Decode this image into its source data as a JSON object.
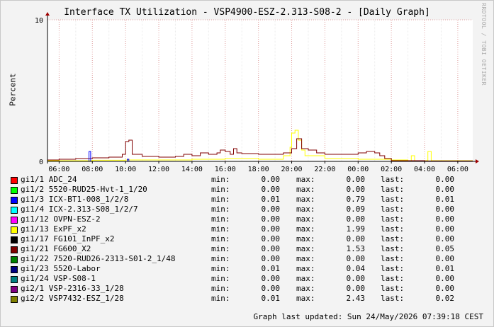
{
  "title": "Interface TX Utilization - VSP4900-ESZ-2.313-S08-2 - [Daily Graph]",
  "watermark": "RRDTOOL / TOBI OETIKER",
  "colors": {
    "background": "#f3f3f3",
    "plot": "#ffffff",
    "grid": "#e08080",
    "axis": "#000000",
    "arrow": "#a00000"
  },
  "chart_data": {
    "type": "line",
    "ylabel": "Percent",
    "ylim": [
      0,
      10
    ],
    "y_ticks": [
      "0",
      "10"
    ],
    "x_ticks": [
      "06:00",
      "08:00",
      "10:00",
      "12:00",
      "14:00",
      "16:00",
      "18:00",
      "20:00",
      "22:00",
      "00:00",
      "02:00",
      "04:00",
      "06:00"
    ],
    "x_tick_hours": [
      6,
      8,
      10,
      12,
      14,
      16,
      18,
      20,
      22,
      24,
      26,
      28,
      30
    ],
    "x_range_hours": [
      5.3,
      30.9
    ],
    "series": [
      {
        "name": "gi1/13 ExPF_x2",
        "color": "#ffff00",
        "points": [
          [
            5.3,
            0.05
          ],
          [
            8,
            0.08
          ],
          [
            10,
            0.1
          ],
          [
            12,
            0.1
          ],
          [
            14,
            0.15
          ],
          [
            16,
            0.2
          ],
          [
            18,
            0.15
          ],
          [
            19.5,
            0.4
          ],
          [
            19.9,
            1.0
          ],
          [
            20.0,
            2.0
          ],
          [
            20.2,
            2.2
          ],
          [
            20.4,
            1.5
          ],
          [
            20.6,
            0.8
          ],
          [
            20.8,
            0.4
          ],
          [
            22,
            0.2
          ],
          [
            24,
            0.15
          ],
          [
            26,
            0.1
          ],
          [
            27,
            0.05
          ],
          [
            27.2,
            0.4
          ],
          [
            27.4,
            0.05
          ],
          [
            28,
            0.05
          ],
          [
            28.2,
            0.7
          ],
          [
            28.4,
            0.05
          ],
          [
            30.9,
            0.05
          ]
        ]
      },
      {
        "name": "gi1/21 FG600_X2",
        "color": "#800000",
        "points": [
          [
            5.3,
            0.1
          ],
          [
            6,
            0.15
          ],
          [
            7,
            0.2
          ],
          [
            8,
            0.25
          ],
          [
            9,
            0.3
          ],
          [
            9.5,
            0.3
          ],
          [
            9.8,
            0.5
          ],
          [
            10.0,
            1.4
          ],
          [
            10.2,
            1.5
          ],
          [
            10.4,
            0.5
          ],
          [
            11,
            0.35
          ],
          [
            12,
            0.3
          ],
          [
            13,
            0.35
          ],
          [
            13.5,
            0.5
          ],
          [
            14,
            0.4
          ],
          [
            14.5,
            0.6
          ],
          [
            15,
            0.5
          ],
          [
            15.5,
            0.6
          ],
          [
            15.7,
            0.8
          ],
          [
            16,
            0.7
          ],
          [
            16.3,
            0.5
          ],
          [
            16.5,
            0.9
          ],
          [
            16.7,
            0.6
          ],
          [
            17,
            0.55
          ],
          [
            18,
            0.5
          ],
          [
            19,
            0.5
          ],
          [
            19.5,
            0.6
          ],
          [
            20,
            0.9
          ],
          [
            20.3,
            1.6
          ],
          [
            20.6,
            0.9
          ],
          [
            21,
            0.8
          ],
          [
            21.5,
            0.6
          ],
          [
            22,
            0.5
          ],
          [
            23,
            0.5
          ],
          [
            24,
            0.6
          ],
          [
            24.5,
            0.7
          ],
          [
            25,
            0.6
          ],
          [
            25.3,
            0.4
          ],
          [
            25.6,
            0.2
          ],
          [
            26,
            0.05
          ],
          [
            27,
            0.05
          ],
          [
            28,
            0.03
          ],
          [
            30,
            0.03
          ],
          [
            30.9,
            0.03
          ]
        ]
      },
      {
        "name": "gi1/3 ICX-BT1-008_1/2/8",
        "color": "#0000ff",
        "points": [
          [
            5.3,
            0
          ],
          [
            7.7,
            0
          ],
          [
            7.8,
            0.7
          ],
          [
            7.9,
            0
          ],
          [
            10.0,
            0
          ],
          [
            10.1,
            0.15
          ],
          [
            10.2,
            0
          ],
          [
            30.9,
            0
          ]
        ]
      }
    ]
  },
  "legend": [
    {
      "color": "#ff0000",
      "name": "gi1/1 ADC_24",
      "min": "0.00",
      "max": "0.00",
      "last": "0.00"
    },
    {
      "color": "#00ff00",
      "name": "gi1/2 5520-RUD25-Hvt-1_1/20",
      "min": "0.00",
      "max": "0.00",
      "last": "0.00"
    },
    {
      "color": "#0000ff",
      "name": "gi1/3 ICX-BT1-008_1/2/8",
      "min": "0.01",
      "max": "0.79",
      "last": "0.01"
    },
    {
      "color": "#00ffff",
      "name": "gi1/4 ICX-2.313-S08_1/2/7",
      "min": "0.00",
      "max": "0.09",
      "last": "0.00"
    },
    {
      "color": "#ff00ff",
      "name": "gi1/12 OVPN-ESZ-2",
      "min": "0.00",
      "max": "0.00",
      "last": "0.00"
    },
    {
      "color": "#ffff00",
      "name": "gi1/13 ExPF_x2",
      "min": "0.00",
      "max": "1.99",
      "last": "0.00"
    },
    {
      "color": "#000000",
      "name": "gi1/17 FG101_InPF_x2",
      "min": "0.00",
      "max": "0.00",
      "last": "0.00"
    },
    {
      "color": "#800000",
      "name": "gi1/21 FG600_X2",
      "min": "0.00",
      "max": "1.53",
      "last": "0.05"
    },
    {
      "color": "#008000",
      "name": "gi1/22 7520-RUD26-2313-S01-2_1/48",
      "min": "0.00",
      "max": "0.00",
      "last": "0.00"
    },
    {
      "color": "#000080",
      "name": "gi1/23 5520-Labor",
      "min": "0.01",
      "max": "0.04",
      "last": "0.01"
    },
    {
      "color": "#008080",
      "name": "gi1/24 VSP-S08-1",
      "min": "0.00",
      "max": "0.00",
      "last": "0.00"
    },
    {
      "color": "#800080",
      "name": "gi2/1 VSP-2316-33_1/28",
      "min": "0.00",
      "max": "0.00",
      "last": "0.00"
    },
    {
      "color": "#808000",
      "name": "gi2/2 VSP7432-ESZ_1/28",
      "min": "0.01",
      "max": "2.43",
      "last": "0.02"
    }
  ],
  "labels": {
    "min": "min:",
    "max": "max:",
    "last": "last:"
  },
  "updated": "Graph last updated: Sun 24/May/2026 07:39:18 CEST"
}
